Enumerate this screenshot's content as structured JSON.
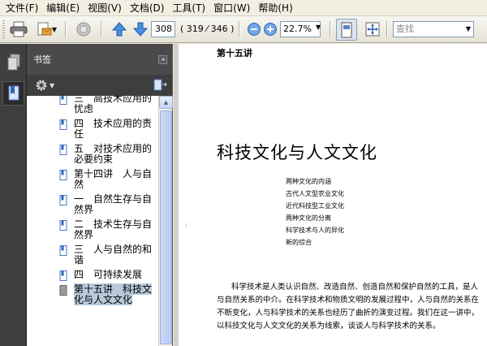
{
  "menu": [
    "文件(F)",
    "编辑(E)",
    "视图(V)",
    "文档(D)",
    "工具(T)",
    "窗口(W)",
    "帮助(H)"
  ],
  "toolbar": {
    "page_current": "308",
    "page_count": "( 319 ⁄ 346 )",
    "zoom": "22.7%",
    "find_placeholder": "查找"
  },
  "bookmarks": {
    "title": "书签",
    "items": [
      {
        "label": "三　高技术应用的忧虑",
        "selected": false
      },
      {
        "label": "四　技术应用的责任",
        "selected": false
      },
      {
        "label": "五　对技术应用的必要约束",
        "selected": false
      },
      {
        "label": "第十四讲　人与自然",
        "selected": false
      },
      {
        "label": "一　自然生存与自然界",
        "selected": false
      },
      {
        "label": "二　技术生存与自然界",
        "selected": false
      },
      {
        "label": "三　人与自然的和谐",
        "selected": false
      },
      {
        "label": "四　可持续发展",
        "selected": false
      },
      {
        "label": "第十五讲　科技文化与人文文化",
        "selected": true
      }
    ]
  },
  "document": {
    "lecture_heading": "第十五讲",
    "title": "科技文化与人文文化",
    "outline": [
      "两种文化的内涵",
      "古代人文型农业文化",
      "近代科技型工业文化",
      "两种文化的分离",
      "科学技术与人的异化",
      "新的综合"
    ],
    "paragraph": "科学技术是人类认识自然、改造自然、创造自然和保护自然的工具，是人与自然关系的中介。在科学技术和物质文明的发展过程中，人与自然的关系在不断变化，人与科学技术的关系也经历了曲折的演变过程。我们在这一讲中，以科技文化与人文文化的关系为线索，谈谈人与科学技术的关系。",
    "margin_mark": ":"
  }
}
